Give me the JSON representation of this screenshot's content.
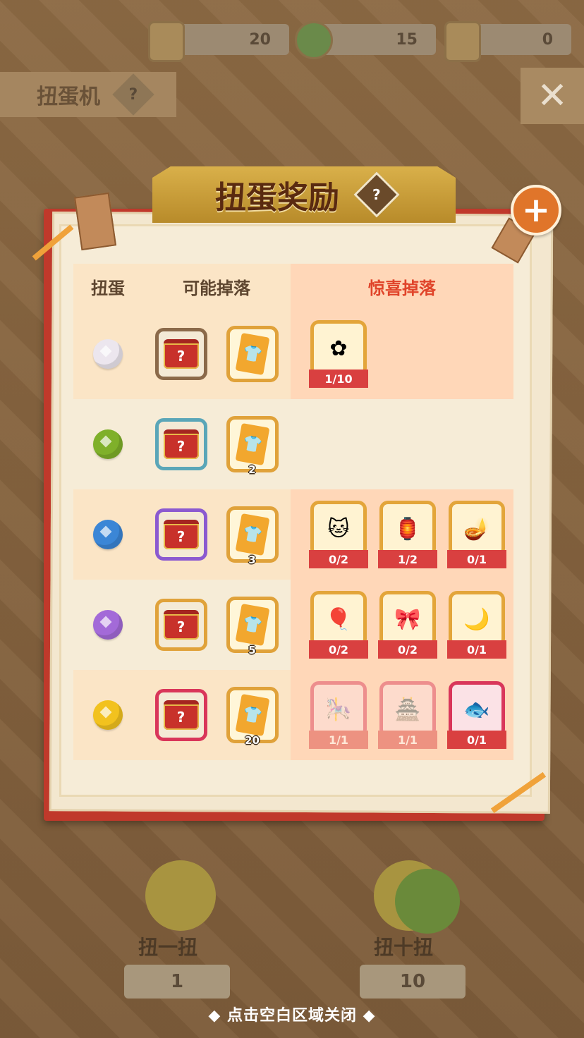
{
  "resources": [
    {
      "icon": "ticket-icon",
      "value": "20"
    },
    {
      "icon": "coin-icon",
      "value": "15"
    },
    {
      "icon": "special-ticket-icon",
      "value": "0"
    }
  ],
  "background": {
    "title": "扭蛋机",
    "help_icon": "?",
    "close_icon": "✕",
    "pull_one": {
      "label": "扭一扭",
      "cost": "1"
    },
    "pull_ten": {
      "label": "扭十扭",
      "cost": "10"
    },
    "close_hint": "◆ 点击空白区域关闭 ◆"
  },
  "dialog": {
    "title": "扭蛋奖励",
    "help_icon": "?",
    "close_icon": "+"
  },
  "table": {
    "headers": {
      "egg": "扭蛋",
      "drops": "可能掉落",
      "surprise": "惊喜掉落"
    },
    "rows": [
      {
        "egg_color": "#ece6ee",
        "chest_border": "#8b6a4a",
        "ticket_qty": "",
        "surprise": [
          {
            "icon": "blue-flower-icon",
            "glyph": "✿",
            "count": "1/10",
            "done": false
          }
        ]
      },
      {
        "egg_color": "#7fb02a",
        "chest_border": "#5aa6b8",
        "ticket_qty": "2",
        "surprise": []
      },
      {
        "egg_color": "#3b86d6",
        "chest_border": "#8b5ad0",
        "ticket_qty": "3",
        "surprise": [
          {
            "icon": "ninja-cat-icon",
            "glyph": "🐱",
            "count": "0/2",
            "done": false
          },
          {
            "icon": "lantern-icon",
            "glyph": "🏮",
            "count": "1/2",
            "done": false
          },
          {
            "icon": "blue-lamp-icon",
            "glyph": "🪔",
            "count": "0/1",
            "done": false
          }
        ]
      },
      {
        "egg_color": "#a36ad8",
        "chest_border": "#e0a23a",
        "ticket_qty": "5",
        "surprise": [
          {
            "icon": "balloon-cats-icon",
            "glyph": "🎈",
            "count": "0/2",
            "done": false
          },
          {
            "icon": "pink-balloon-icon",
            "glyph": "🎀",
            "count": "0/2",
            "done": false
          },
          {
            "icon": "purple-screen-icon",
            "glyph": "🌙",
            "count": "0/1",
            "done": false
          }
        ]
      },
      {
        "egg_color": "#f2c21e",
        "chest_border": "#d9365a",
        "ticket_qty": "20",
        "surprise": [
          {
            "icon": "carousel-icon",
            "glyph": "🎠",
            "count": "1/1",
            "done": true
          },
          {
            "icon": "house-icon",
            "glyph": "🏯",
            "count": "1/1",
            "done": true
          },
          {
            "icon": "red-fish-icon",
            "glyph": "🐟",
            "count": "0/1",
            "done": false
          }
        ]
      }
    ]
  }
}
